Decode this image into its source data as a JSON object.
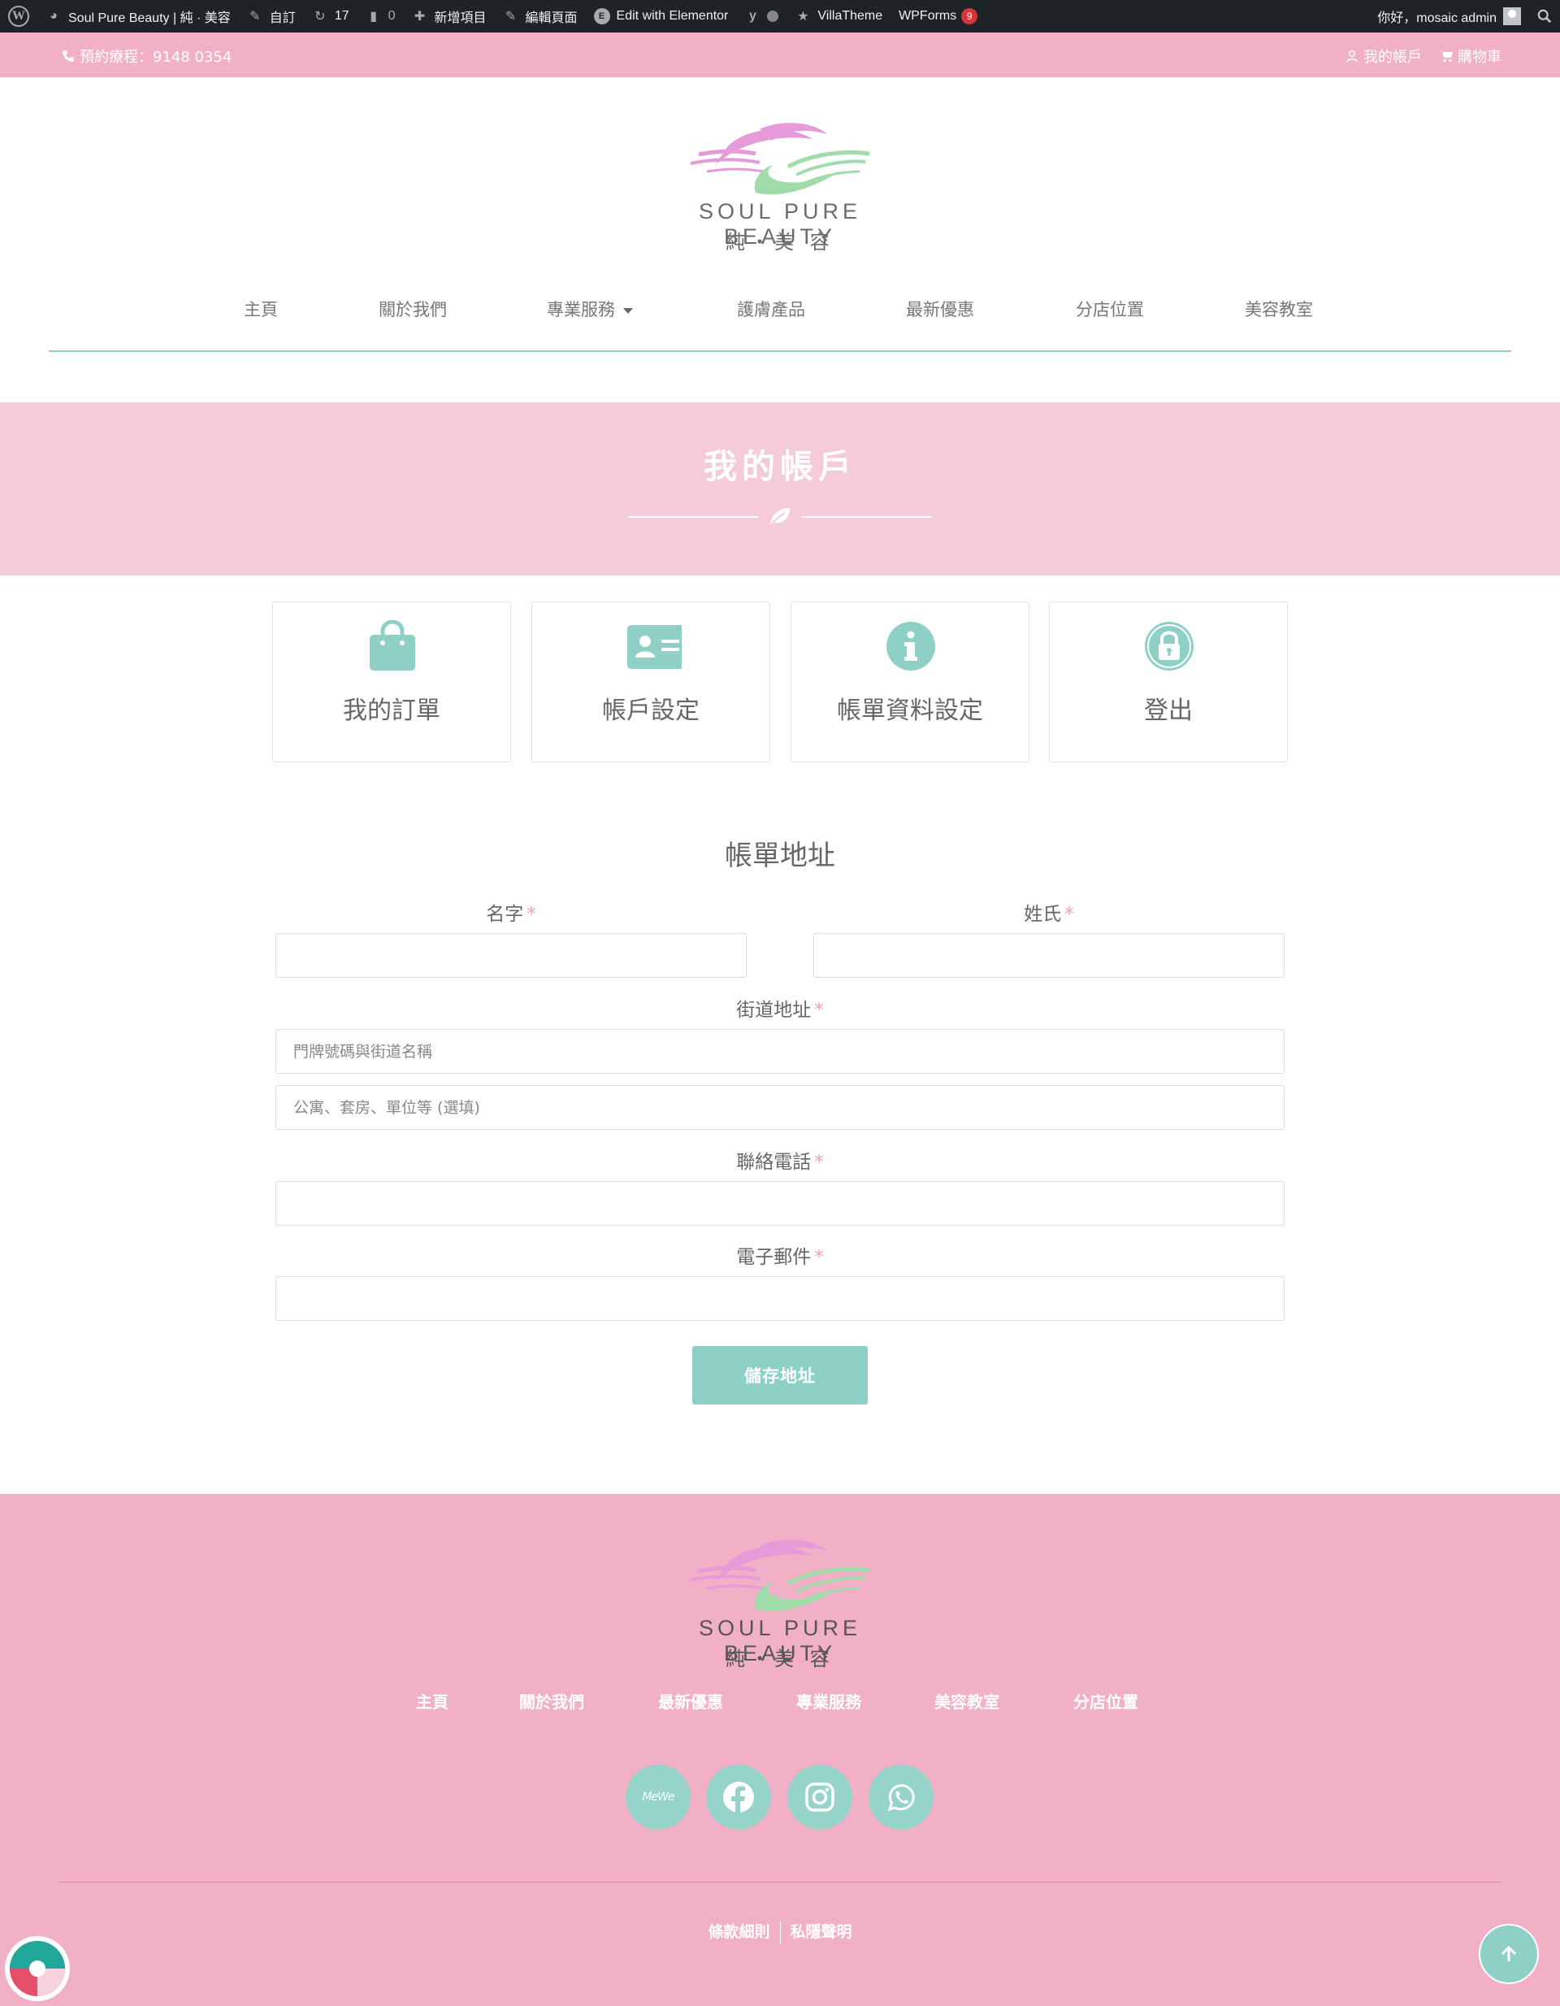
{
  "admin_bar": {
    "site_name": "Soul Pure Beauty | 純 · 美容",
    "customize": "自訂",
    "updates_count": "17",
    "comments_count": "0",
    "new_item": "新增項目",
    "edit_page": "編輯頁面",
    "edit_elementor": "Edit with Elementor",
    "villatheme": "VillaTheme",
    "wpforms": "WPForms",
    "wpforms_badge": "9",
    "greeting": "你好，mosaic admin"
  },
  "topbar": {
    "phone_text": "預約療程：9148 0354",
    "my_account": "我的帳戶",
    "cart": "購物車"
  },
  "logo": {
    "name_en": "SOUL PURE BEAUTY",
    "name_zh": "純・美 容"
  },
  "nav": {
    "items": [
      "主頁",
      "關於我們",
      "專業服務",
      "護膚產品",
      "最新優惠",
      "分店位置",
      "美容教室"
    ]
  },
  "banner": {
    "title": "我的帳戶"
  },
  "account_tiles": [
    {
      "label": "我的訂單",
      "icon": "shopping-bag-icon"
    },
    {
      "label": "帳戶設定",
      "icon": "id-card-icon"
    },
    {
      "label": "帳單資料設定",
      "icon": "info-icon"
    },
    {
      "label": "登出",
      "icon": "lock-icon"
    }
  ],
  "form": {
    "title": "帳單地址",
    "first_name_label": "名字",
    "last_name_label": "姓氏",
    "street_label": "街道地址",
    "street1_placeholder": "門牌號碼與街道名稱",
    "street2_placeholder": "公寓、套房、單位等 (選填)",
    "phone_label": "聯絡電話",
    "email_label": "電子郵件",
    "required_mark": "*",
    "save_button": "儲存地址"
  },
  "footer": {
    "name_en": "SOUL PURE BEAUTY",
    "name_zh": "純・美 容",
    "nav": [
      "主頁",
      "關於我們",
      "最新優惠",
      "專業服務",
      "美容教室",
      "分店位置"
    ],
    "social": [
      {
        "name": "mewe",
        "label": "MeWe"
      },
      {
        "name": "facebook"
      },
      {
        "name": "instagram"
      },
      {
        "name": "whatsapp"
      }
    ],
    "terms": "條款細則",
    "privacy": "私隱聲明"
  },
  "colors": {
    "pink": "#f2b0c7",
    "light_pink": "#f5cad9",
    "teal": "#8fd0c6",
    "admin_bar": "#1d2327"
  }
}
